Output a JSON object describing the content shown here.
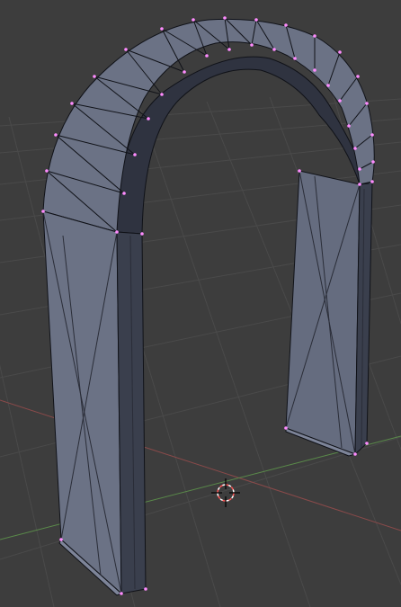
{
  "viewport": {
    "view": "3d-viewport",
    "mode": "edit-mode",
    "object": "arch-mesh"
  },
  "colors": {
    "background": "#3d3d3d",
    "grid_line": "#4a4a4a",
    "x_axis": "#8a4a4a",
    "y_axis": "#5a8a4a",
    "mesh_face": "#6b7285",
    "mesh_face_dark": "#2f3340",
    "mesh_edge": "#101218",
    "vertex": "#ff8cff",
    "cursor": "#ffffff",
    "cursor_ring": "#ff5555"
  },
  "icons": {
    "cursor": "3d-cursor-icon"
  }
}
